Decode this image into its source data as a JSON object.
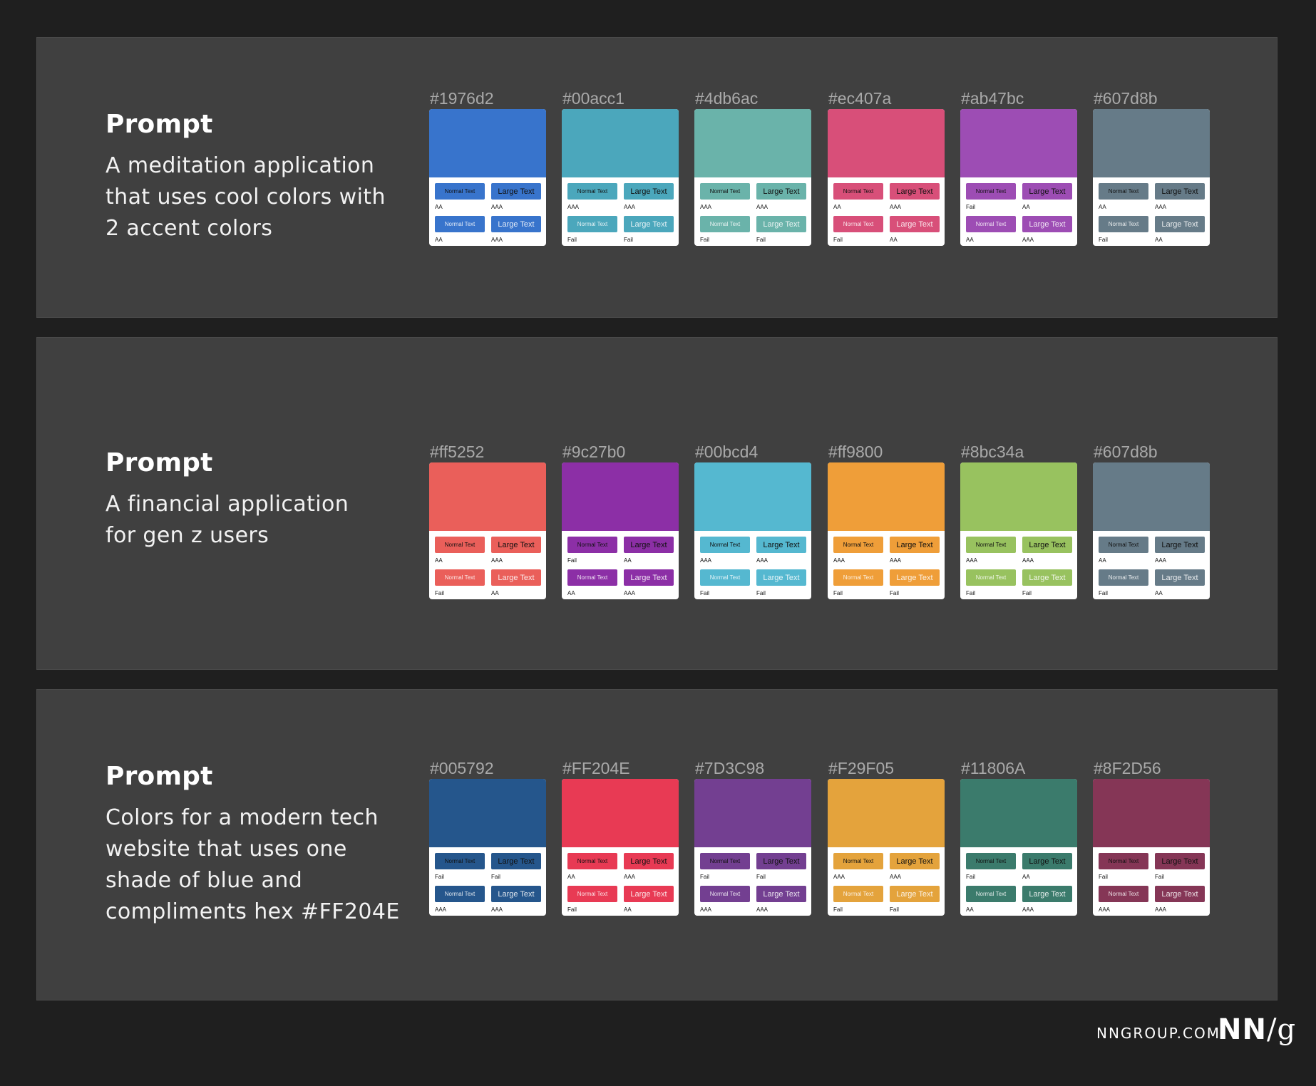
{
  "panels": [
    {
      "heading": "Prompt",
      "body_lines": [
        "A meditation application",
        "that uses cool colors with",
        "2 accent colors"
      ],
      "swatches": [
        {
          "hex": "#1976d2",
          "display": "#3874cc",
          "ratings": [
            "AA",
            "AAA",
            "AA",
            "AAA"
          ]
        },
        {
          "hex": "#00acc1",
          "display": "#4ba7bc",
          "ratings": [
            "AAA",
            "AAA",
            "Fail",
            "Fail"
          ]
        },
        {
          "hex": "#4db6ac",
          "display": "#6ab3aa",
          "ratings": [
            "AAA",
            "AAA",
            "Fail",
            "Fail"
          ]
        },
        {
          "hex": "#ec407a",
          "display": "#d84f79",
          "ratings": [
            "AA",
            "AAA",
            "Fail",
            "AA"
          ]
        },
        {
          "hex": "#ab47bc",
          "display": "#9d4db4",
          "ratings": [
            "Fail",
            "AA",
            "AA",
            "AAA"
          ]
        },
        {
          "hex": "#607d8b",
          "display": "#667b88",
          "ratings": [
            "AA",
            "AAA",
            "Fail",
            "AA"
          ]
        }
      ]
    },
    {
      "heading": "Prompt",
      "body_lines": [
        "A financial application",
        "for gen z users"
      ],
      "swatches": [
        {
          "hex": "#ff5252",
          "display": "#ea5f5a",
          "ratings": [
            "AA",
            "AAA",
            "Fail",
            "AA"
          ]
        },
        {
          "hex": "#9c27b0",
          "display": "#8c2fa6",
          "ratings": [
            "Fail",
            "AA",
            "AA",
            "AAA"
          ]
        },
        {
          "hex": "#00bcd4",
          "display": "#55b8d0",
          "ratings": [
            "AAA",
            "AAA",
            "Fail",
            "Fail"
          ]
        },
        {
          "hex": "#ff9800",
          "display": "#ef9e39",
          "ratings": [
            "AAA",
            "AAA",
            "Fail",
            "Fail"
          ]
        },
        {
          "hex": "#8bc34a",
          "display": "#98c25f",
          "ratings": [
            "AAA",
            "AAA",
            "Fail",
            "Fail"
          ]
        },
        {
          "hex": "#607d8b",
          "display": "#667b88",
          "ratings": [
            "AA",
            "AAA",
            "Fail",
            "AA"
          ]
        }
      ]
    },
    {
      "heading": "Prompt",
      "body_lines": [
        "Colors for a modern tech",
        "website that uses one",
        "shade of blue and",
        "compliments hex #FF204E"
      ],
      "swatches": [
        {
          "hex": "#005792",
          "display": "#25568c",
          "ratings": [
            "Fail",
            "Fail",
            "AAA",
            "AAA"
          ]
        },
        {
          "hex": "#FF204E",
          "display": "#e83a54",
          "ratings": [
            "AA",
            "AAA",
            "Fail",
            "AA"
          ]
        },
        {
          "hex": "#7D3C98",
          "display": "#733f91",
          "ratings": [
            "Fail",
            "Fail",
            "AAA",
            "AAA"
          ]
        },
        {
          "hex": "#F29F05",
          "display": "#e4a33c",
          "ratings": [
            "AAA",
            "AAA",
            "Fail",
            "Fail"
          ]
        },
        {
          "hex": "#11806A",
          "display": "#3b7b6c",
          "ratings": [
            "Fail",
            "AA",
            "AA",
            "AAA"
          ]
        },
        {
          "hex": "#8F2D56",
          "display": "#853656",
          "ratings": [
            "Fail",
            "Fail",
            "AAA",
            "AAA"
          ]
        }
      ]
    }
  ],
  "button_labels": {
    "normal": "Normal Text",
    "large": "Large Text"
  },
  "footer": {
    "site": "NNGROUP.COM",
    "logo_nn": "NN",
    "logo_slash": "/",
    "logo_g": "g"
  }
}
